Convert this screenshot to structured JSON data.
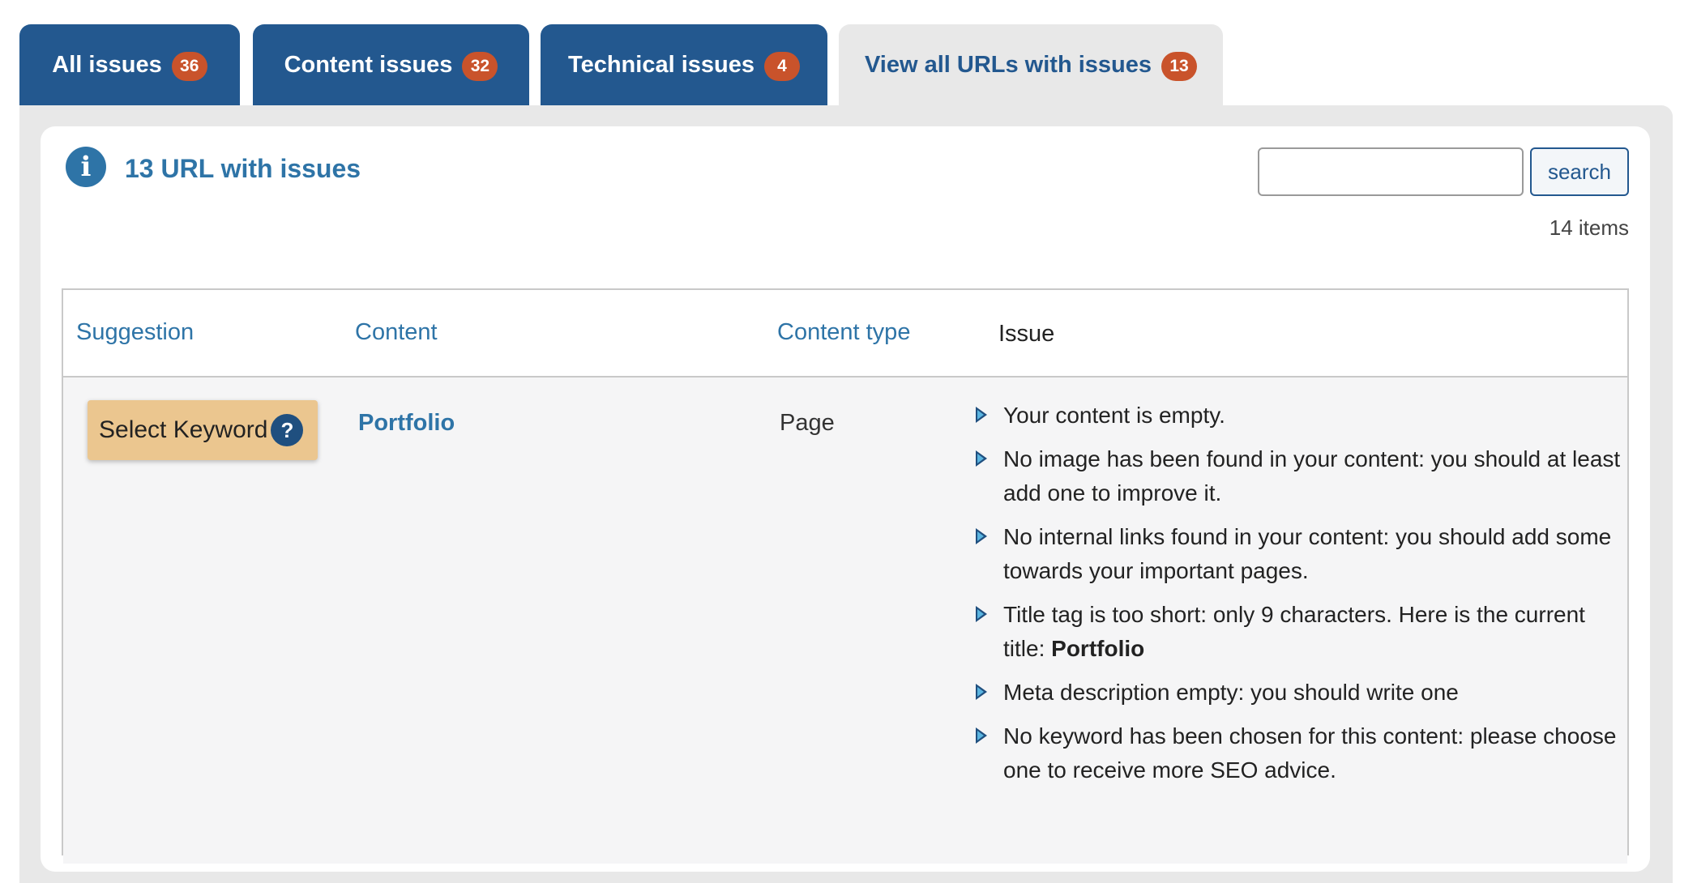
{
  "tabs": [
    {
      "label": "All issues",
      "count": "36"
    },
    {
      "label": "Content issues",
      "count": "32"
    },
    {
      "label": "Technical issues",
      "count": "4"
    },
    {
      "label": "View all URLs with issues",
      "count": "13"
    }
  ],
  "panel": {
    "title": "13 URL with issues",
    "search_value": "",
    "search_label": "search",
    "items_count": "14 items"
  },
  "table": {
    "headers": {
      "suggestion": "Suggestion",
      "content": "Content",
      "content_type": "Content type",
      "issue": "Issue"
    },
    "rows": [
      {
        "suggestion_label": "Select Keyword",
        "help_icon": "?",
        "content": "Portfolio",
        "content_type": "Page",
        "issues": [
          "Your content is empty.",
          "No image has been found in your content: you should at least add one to improve it.",
          "No internal links found in your content: you should add some towards your important pages.",
          {
            "text": "Title tag is too short: only 9 characters. Here is the current title: ",
            "bold": "Portfolio"
          },
          "Meta description empty: you should write one",
          "No keyword has been chosen for this content: please choose one to receive more SEO advice."
        ]
      }
    ]
  },
  "colors": {
    "tab_active_bg": "#23588f",
    "tab_inactive_bg": "#e8e8e8",
    "badge": "#c9532b",
    "accent": "#2e74a7",
    "keyword_button": "#ebc68f"
  },
  "icons": {
    "info": "info-icon",
    "help": "help-icon",
    "bullet": "arrow-bullet-icon"
  }
}
